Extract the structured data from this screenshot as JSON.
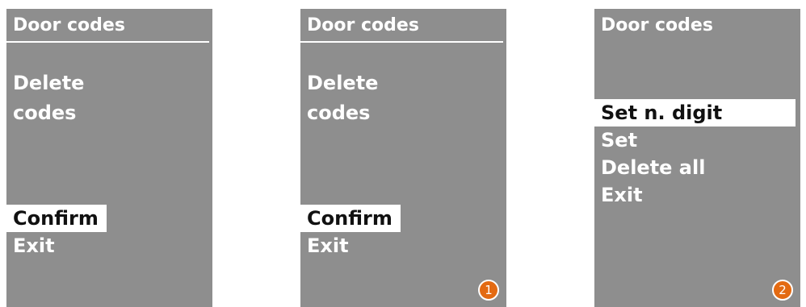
{
  "colors": {
    "screen_background": "#8e8e8e",
    "text": "#ffffff",
    "selected_background": "#ffffff",
    "selected_text": "#111111",
    "badge": "#e36a12"
  },
  "screens": [
    {
      "title": "Door codes",
      "heading": [
        "Delete",
        "codes"
      ],
      "menu": [
        "Confirm",
        "Exit"
      ],
      "selected": "Confirm"
    },
    {
      "title": "Door codes",
      "heading": [
        "Delete",
        "codes"
      ],
      "menu": [
        "Confirm",
        "Exit"
      ],
      "selected": "Confirm",
      "step": "1"
    },
    {
      "title": "Door codes",
      "menu": [
        "Set n. digit",
        "Set",
        "Delete all",
        "Exit"
      ],
      "selected": "Set n. digit",
      "step": "2"
    }
  ]
}
